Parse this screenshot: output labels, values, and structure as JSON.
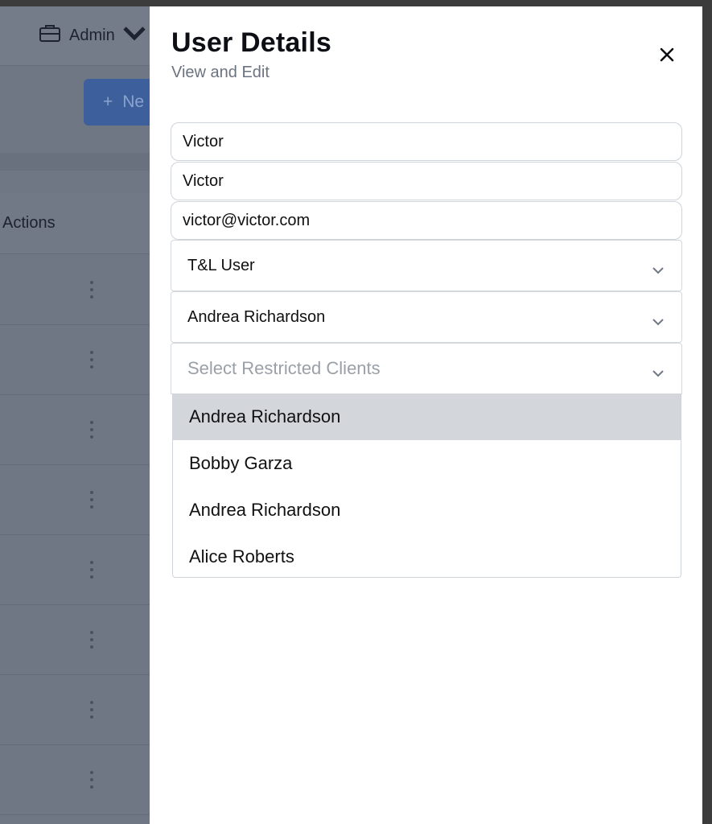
{
  "background": {
    "account_label": "Admin",
    "new_button_label": "Ne",
    "table_actions_header": "Actions",
    "row_count": 8
  },
  "drawer": {
    "title": "User Details",
    "subtitle": "View and Edit",
    "close_icon": "close-icon",
    "fields": {
      "first_name": "Victor",
      "last_name": "Victor",
      "email": "victor@victor.com"
    },
    "role_select": {
      "value": "T&L User"
    },
    "manager_select": {
      "value": "Andrea Richardson"
    },
    "restricted_clients_select": {
      "placeholder": "Select Restricted Clients"
    },
    "dropdown_options": [
      {
        "label": "Andrea Richardson",
        "highlighted": true
      },
      {
        "label": "Bobby Garza",
        "highlighted": false
      },
      {
        "label": "Andrea Richardson",
        "highlighted": false
      },
      {
        "label": "Alice Roberts",
        "highlighted": false
      }
    ]
  },
  "colors": {
    "overlay": "#6f7684",
    "primary_button": "#3d5f9c",
    "highlight": "#d3d6da"
  }
}
